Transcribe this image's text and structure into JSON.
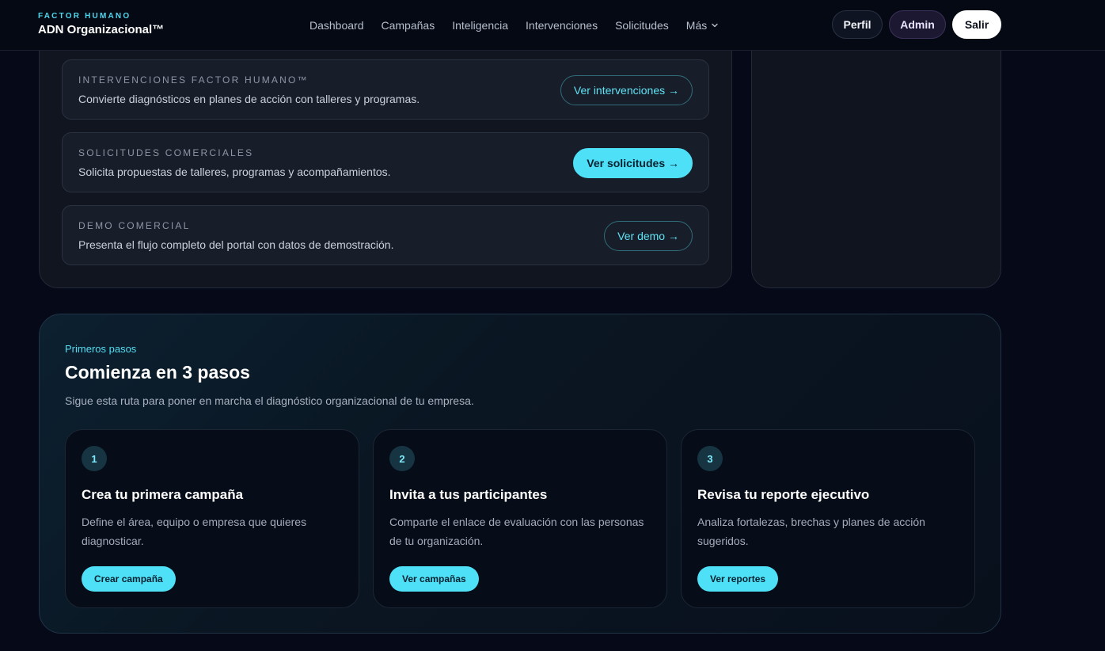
{
  "header": {
    "brand_eyebrow": "FACTOR HUMANO",
    "brand_name": "ADN Organizacional™",
    "nav": [
      "Dashboard",
      "Campañas",
      "Inteligencia",
      "Intervenciones",
      "Solicitudes",
      "Más"
    ],
    "actions": {
      "perfil": "Perfil",
      "admin": "Admin",
      "salir": "Salir"
    }
  },
  "modules": [
    {
      "eyebrow": "INTERVENCIONES FACTOR HUMANO™",
      "description": "Convierte diagnósticos en planes de acción con talleres y programas.",
      "button": "Ver intervenciones →"
    },
    {
      "eyebrow": "SOLICITUDES COMERCIALES",
      "description": "Solicita propuestas de talleres, programas y acompañamientos.",
      "button": "Ver solicitudes →"
    },
    {
      "eyebrow": "DEMO COMERCIAL",
      "description": "Presenta el flujo completo del portal con datos de demostración.",
      "button": "Ver demo →"
    }
  ],
  "steps_section": {
    "eyebrow": "Primeros pasos",
    "title": "Comienza en 3 pasos",
    "subtitle": "Sigue esta ruta para poner en marcha el diagnóstico organizacional de tu empresa.",
    "steps": [
      {
        "number": "1",
        "title": "Crea tu primera campaña",
        "description": "Define el área, equipo o empresa que quieres diagnosticar.",
        "button": "Crear campaña"
      },
      {
        "number": "2",
        "title": "Invita a tus participantes",
        "description": "Comparte el enlace de evaluación con las personas de tu organización.",
        "button": "Ver campañas"
      },
      {
        "number": "3",
        "title": "Revisa tu reporte ejecutivo",
        "description": "Analiza fortalezas, brechas y planes de acción sugeridos.",
        "button": "Ver reportes"
      }
    ]
  },
  "colors": {
    "accent": "#4ee0f6",
    "background": "#060a18",
    "admin": "#1d1832"
  },
  "icons": {
    "more_menu": "chevron-down-icon"
  }
}
